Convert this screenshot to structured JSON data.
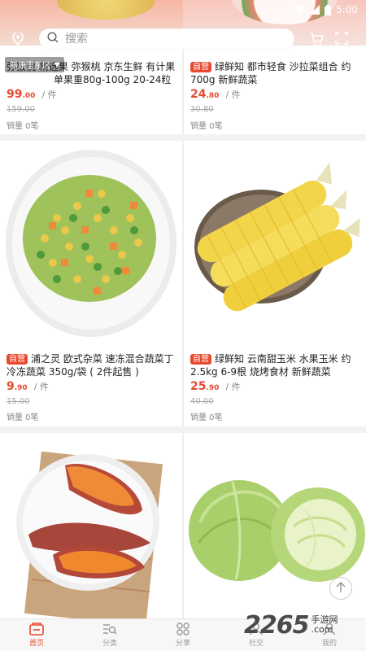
{
  "status_bar": {
    "time": "5:00"
  },
  "header": {
    "search_placeholder": "搜索",
    "region": "新康里东区"
  },
  "products": [
    {
      "title_prefix": "",
      "title": "弥猴桃 精选果 弥猴桃 京东生鲜 有计果 单果重80g-100g 20-24粒",
      "price_int": "99",
      "price_dec": ".00",
      "unit": "/ 件",
      "old_price": "159.00",
      "sales": "销量 0笔"
    },
    {
      "title_prefix": "自营",
      "title": "绿鲜知 都市轻食 沙拉菜组合 约700g 新鲜蔬菜",
      "price_int": "24",
      "price_dec": ".80",
      "unit": "/ 件",
      "old_price": "30.80",
      "sales": "销量 0笔"
    },
    {
      "title_prefix": "自营",
      "title": "浦之灵 欧式杂菜 速冻混合蔬菜丁 冷冻蔬菜 350g/袋 ( 2件起售 )",
      "price_int": "9",
      "price_dec": ".90",
      "unit": "/ 件",
      "old_price": "15.00",
      "sales": "销量 0笔"
    },
    {
      "title_prefix": "自营",
      "title": "绿鲜知 云南甜玉米 水果玉米 约2.5kg 6-9根 烧烤食材 新鲜蔬菜",
      "price_int": "25",
      "price_dec": ".90",
      "unit": "/ 件",
      "old_price": "40.00",
      "sales": "销量 0笔"
    },
    {
      "title_prefix": "",
      "title": "",
      "price_int": "",
      "price_dec": "",
      "unit": "",
      "old_price": "",
      "sales": ""
    },
    {
      "title_prefix": "",
      "title": "",
      "price_int": "",
      "price_dec": "",
      "unit": "",
      "old_price": "",
      "sales": ""
    }
  ],
  "tabs": [
    {
      "label": "首页",
      "icon": "home-icon",
      "active": true
    },
    {
      "label": "分类",
      "icon": "category-icon",
      "active": false
    },
    {
      "label": "分享",
      "icon": "share-icon",
      "active": false
    },
    {
      "label": "社交",
      "icon": "social-icon",
      "active": false
    },
    {
      "label": "我的",
      "icon": "profile-icon",
      "active": false
    }
  ],
  "watermark": {
    "number": "2265",
    "suffix": ".com",
    "text": "手游网"
  },
  "colors": {
    "accent": "#e84a2f",
    "header": "#f7b6a3"
  }
}
